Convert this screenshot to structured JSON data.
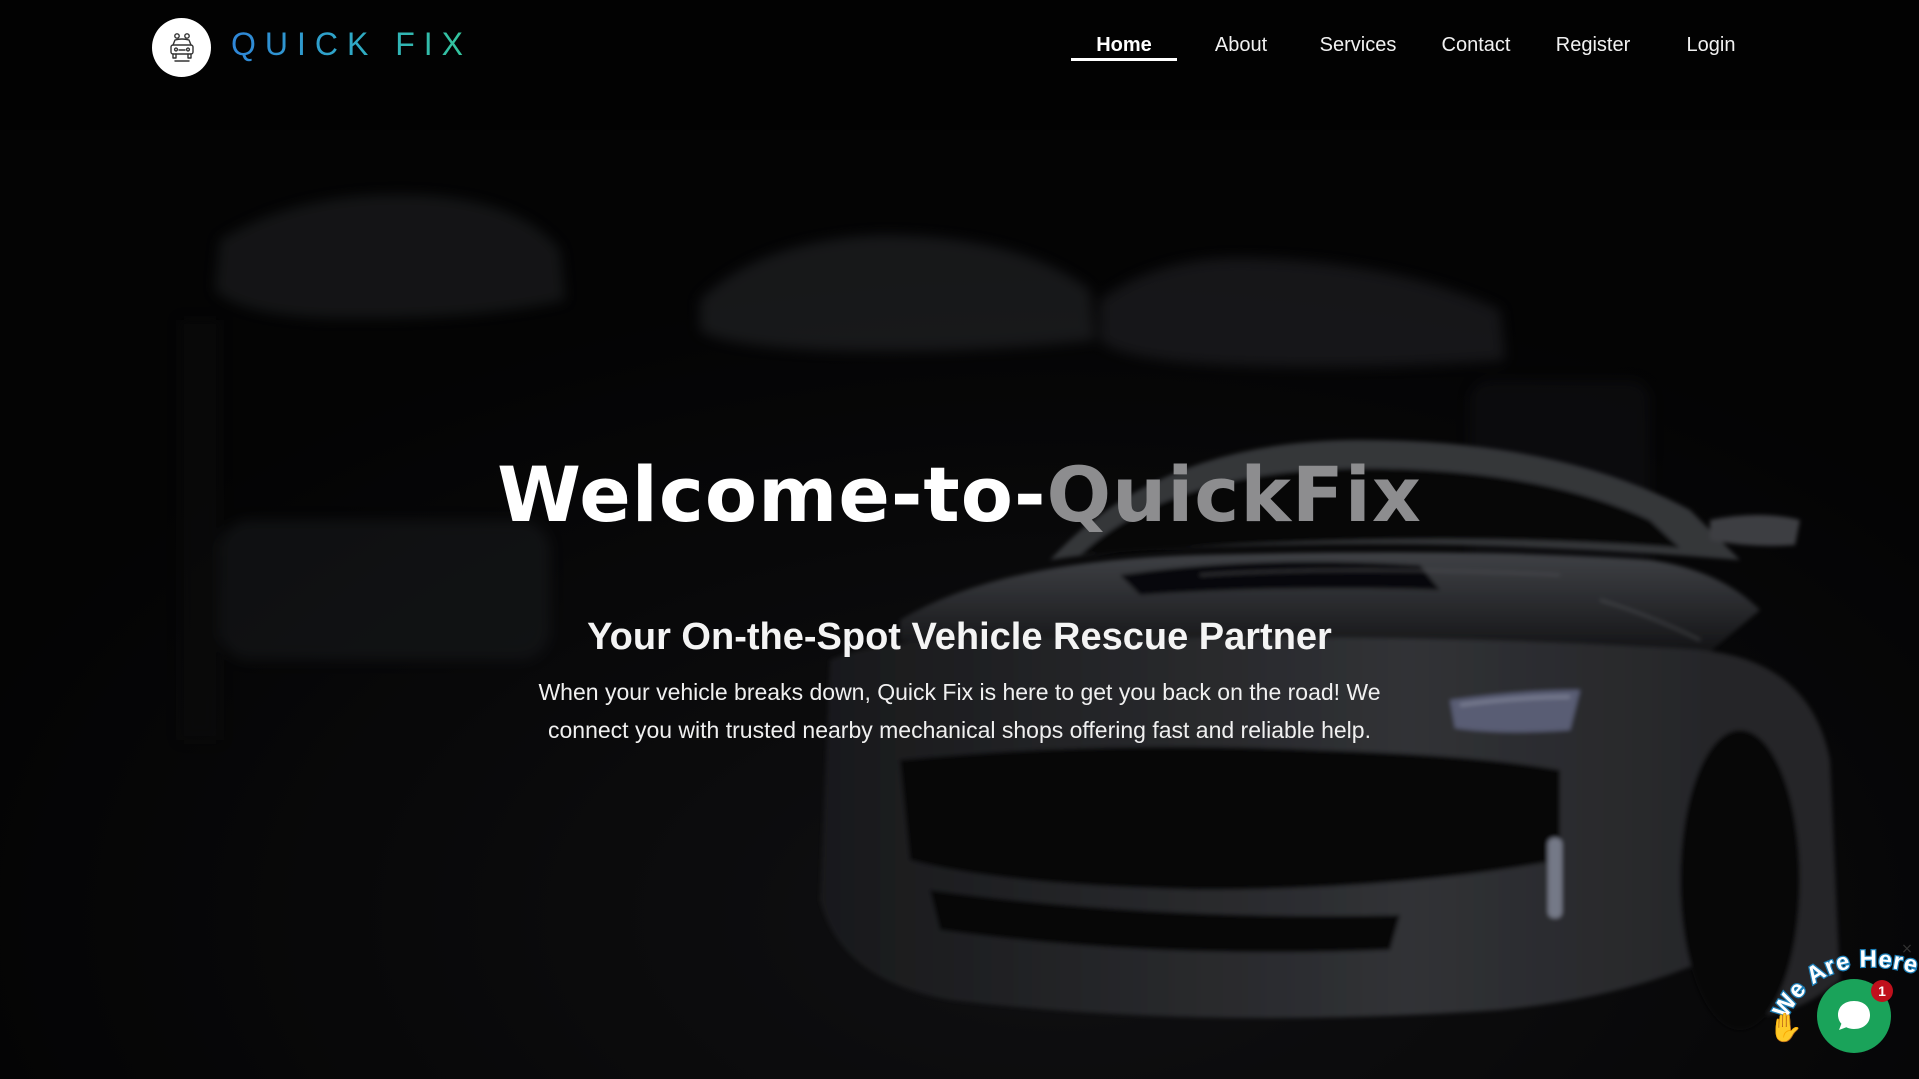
{
  "brand": {
    "name": "QUICK FIX",
    "logo_icon": "car-repair-icon"
  },
  "nav": {
    "items": [
      {
        "label": "Home",
        "active": true
      },
      {
        "label": "About",
        "active": false
      },
      {
        "label": "Services",
        "active": false
      },
      {
        "label": "Contact",
        "active": false
      },
      {
        "label": "Register",
        "active": false
      },
      {
        "label": "Login",
        "active": false
      }
    ]
  },
  "hero": {
    "title_part1": "Welcome-to-",
    "title_part2": "QuickFix",
    "subtitle": "Your On-the-Spot Vehicle Rescue Partner",
    "description": "When your vehicle breaks down, Quick Fix is here to get you back on the road! We connect you with trusted nearby mechanical shops offering fast and reliable help."
  },
  "chat": {
    "banner_text": "We Are Here!",
    "badge_count": "1",
    "icon": "chat-bubble-icon",
    "wave_icon": "waving-hand-icon",
    "close_symbol": "×"
  },
  "colors": {
    "brand_gradient_start": "#2f86d8",
    "brand_gradient_end": "#34c79a",
    "chat_green": "#1aa35a",
    "badge_red": "#c0101c",
    "title_grey": "#8d8d8f"
  }
}
